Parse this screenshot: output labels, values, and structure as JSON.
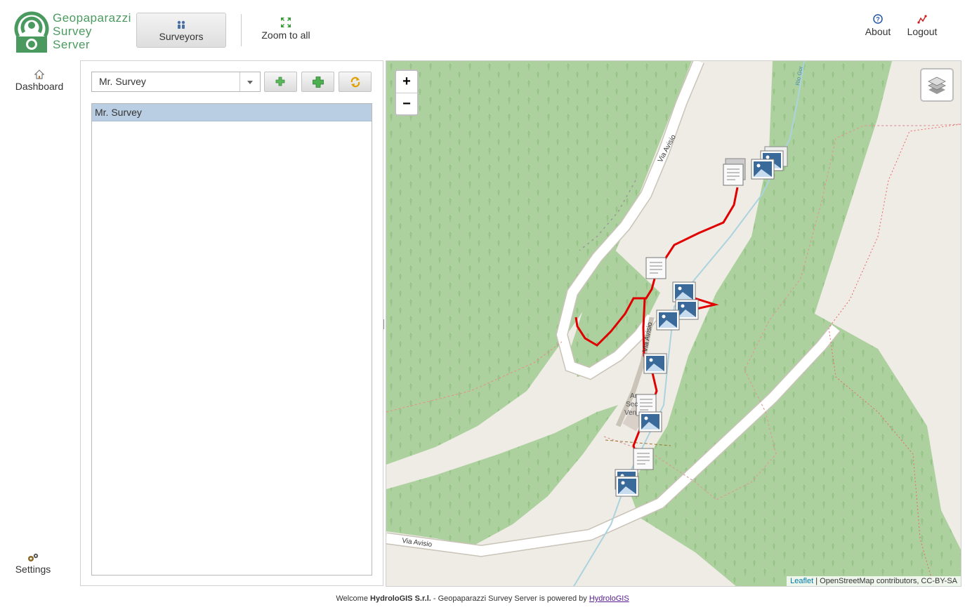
{
  "app": {
    "logo_lines": [
      "Geopaparazzi",
      "Survey",
      "Server"
    ],
    "brand_color": "#4a9a5f"
  },
  "header": {
    "surveyors_label": "Surveyors",
    "zoom_all_label": "Zoom to all",
    "about_label": "About",
    "logout_label": "Logout"
  },
  "nav": {
    "dashboard_label": "Dashboard",
    "settings_label": "Settings"
  },
  "surveyor_panel": {
    "selected": "Mr. Survey",
    "list": [
      "Mr. Survey"
    ]
  },
  "map": {
    "zoom_in": "+",
    "zoom_out": "−",
    "road_labels": [
      "Via Avisio",
      "Via Avisio",
      "Via Avisio"
    ],
    "stream_label": "Rio Gor",
    "place_label": [
      "Ar",
      "Sec",
      "Ven"
    ],
    "attribution": {
      "leaflet": "Leaflet",
      "rest": " | OpenStreetMap contributors, CC-BY-SA"
    },
    "colors": {
      "forest": "#add19e",
      "land": "#efece6",
      "track": "#e00000",
      "stream": "#aad3df"
    }
  },
  "footer": {
    "welcome": "Welcome ",
    "org": "HydroloGIS S.r.l.",
    "middle": " - Geopaparazzi Survey Server is powered by ",
    "link": "HydroloGIS"
  }
}
